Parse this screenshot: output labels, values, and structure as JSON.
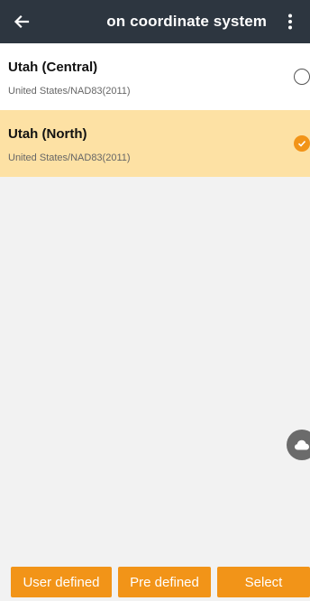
{
  "appbar": {
    "title": "on coordinate system",
    "back_icon": "arrow-left-icon",
    "menu_icon": "more-vert-icon"
  },
  "list": {
    "items": [
      {
        "name": "Utah (Central)",
        "subtitle": "United States/NAD83(2011)",
        "selected": false
      },
      {
        "name": "Utah (North)",
        "subtitle": "United States/NAD83(2011)",
        "selected": true
      }
    ]
  },
  "fab": {
    "icon": "cloud-icon"
  },
  "buttons": {
    "user_defined": "User defined",
    "pre_defined": "Pre defined",
    "select": "Select"
  },
  "colors": {
    "appbar": "#2d3640",
    "accent": "#f29418",
    "selected_row": "#fde1a4",
    "background": "#f2f2f2"
  }
}
